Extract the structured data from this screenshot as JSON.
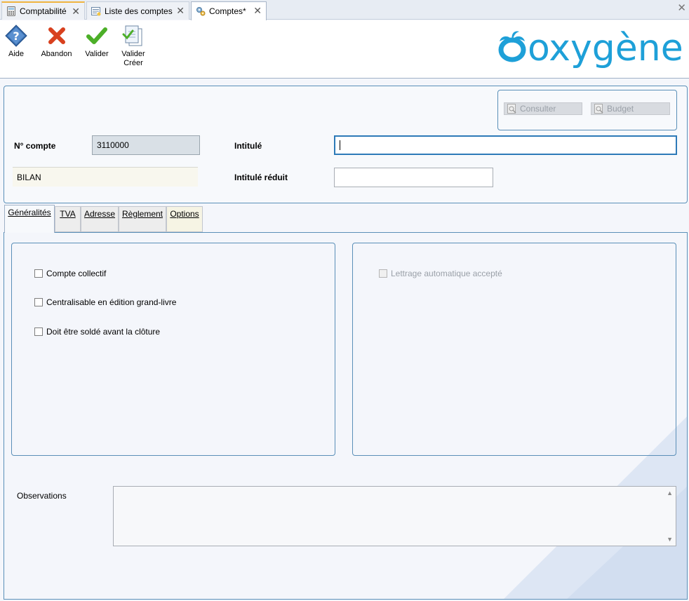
{
  "tabs": [
    {
      "label": "Comptabilité",
      "icon": "calculator-icon"
    },
    {
      "label": "Liste des comptes",
      "icon": "list-icon"
    },
    {
      "label": "Comptes*",
      "icon": "gears-icon"
    }
  ],
  "toolbar": {
    "aide": "Aide",
    "abandon": "Abandon",
    "valider": "Valider",
    "valider_creer_line1": "Valider",
    "valider_creer_line2": "Créer"
  },
  "logo_text": "oxygène",
  "header": {
    "consulter": "Consulter",
    "budget": "Budget",
    "num_compte_label": "N° compte",
    "num_compte_value": "3110000",
    "bilan_value": "BILAN",
    "intitule_label": "Intitulé",
    "intitule_value": "",
    "intitule_reduit_label": "Intitulé réduit",
    "intitule_reduit_value": ""
  },
  "inner_tabs": {
    "generalites": "Généralités",
    "tva": "TVA",
    "adresse": "Adresse",
    "reglement": "Règlement",
    "options": "Options"
  },
  "generalites": {
    "compte_collectif": "Compte collectif",
    "centralisable": "Centralisable en édition grand-livre",
    "doit_etre_solde": "Doit être soldé avant la clôture",
    "lettrage": "Lettrage automatique accepté"
  },
  "observations_label": "Observations",
  "colors": {
    "accent": "#1ea0d8",
    "border": "#5a8fb8",
    "tab_highlight": "#f0b440"
  }
}
